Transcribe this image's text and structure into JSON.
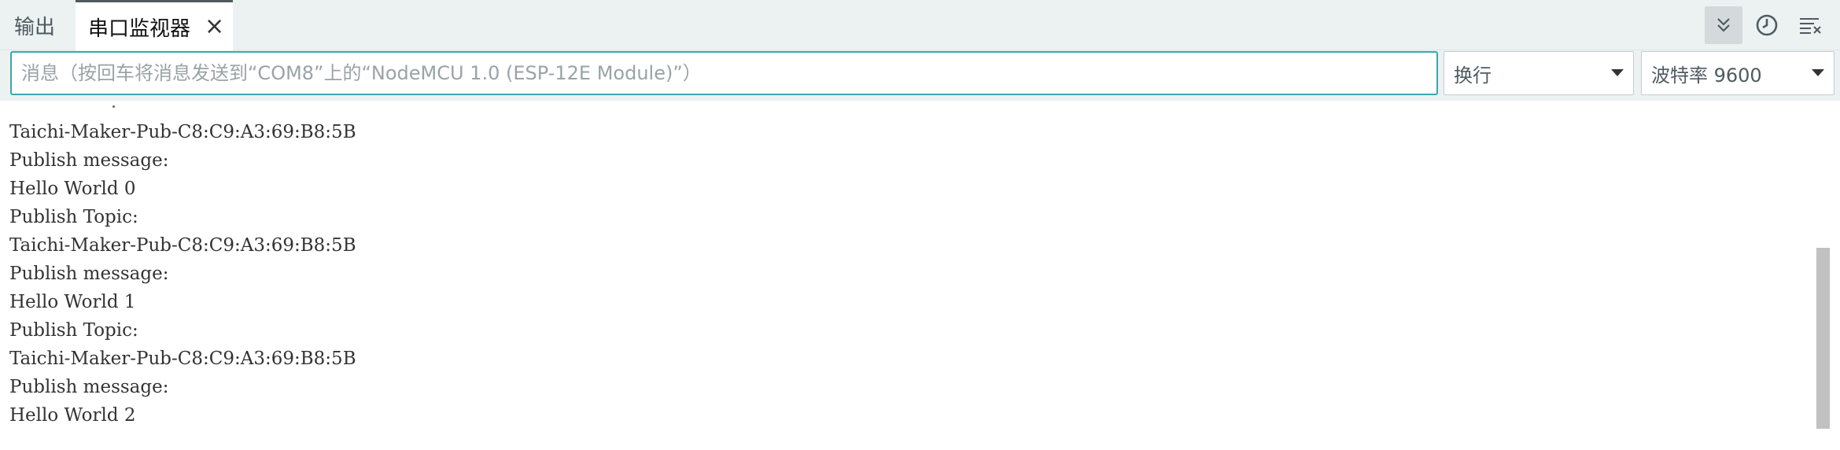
{
  "tabs": {
    "output_label": "输出",
    "serial_label": "串口监视器",
    "close_symbol": "×"
  },
  "toolbar": {
    "autoscroll_icon": "double-chevron-down-icon",
    "timestamp_icon": "clock-icon",
    "clear_icon": "clear-output-icon"
  },
  "input": {
    "placeholder": "消息（按回车将消息发送到“COM8”上的“NodeMCU 1.0 (ESP-12E Module)”）",
    "value": ""
  },
  "line_ending": {
    "selected": "换行"
  },
  "baud": {
    "selected": "波特率 9600"
  },
  "output_lines": [
    "Taichi-Maker-Pub-C8:C9:A3:69:B8:5B",
    "Publish message:",
    "Hello World 0",
    "Publish Topic:",
    "Taichi-Maker-Pub-C8:C9:A3:69:B8:5B",
    "Publish message:",
    "Hello World 1",
    "Publish Topic:",
    "Taichi-Maker-Pub-C8:C9:A3:69:B8:5B",
    "Publish message:",
    "Hello World 2"
  ],
  "colors": {
    "accent": "#3aa8ad",
    "toolbar_bg": "#ecf1f1",
    "text": "#333333"
  }
}
